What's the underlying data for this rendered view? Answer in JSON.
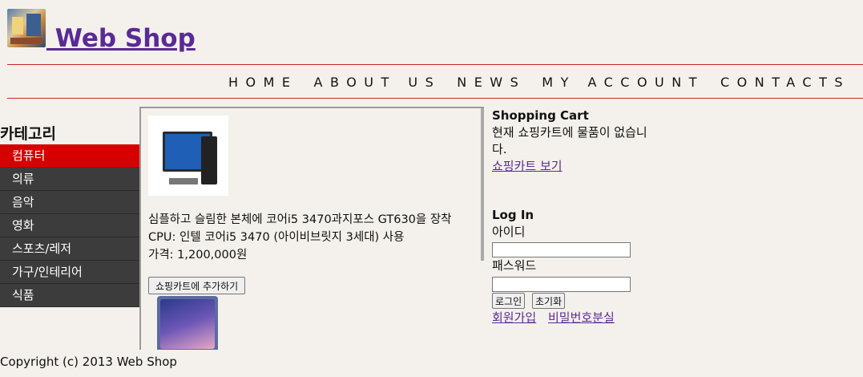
{
  "header": {
    "title": " Web Shop",
    "logo_icon": "shop-logo-icon"
  },
  "nav": {
    "items": [
      "HOME",
      "ABOUT US",
      "NEWS",
      "MY ACCOUNT",
      "CONTACTS"
    ]
  },
  "sidebar": {
    "title": "카테고리",
    "items": [
      "컴퓨터",
      "의류",
      "음악",
      "영화",
      "스포츠/레저",
      "가구/인테리어",
      "식품"
    ],
    "active_color": "#d60000",
    "item_color": "#3c3c3c"
  },
  "product": {
    "description": "심플하고 슬림한 본체에 코어i5 3470과지포스 GT630을 장착 CPU: 인텔 코어i5 3470 (아이비브릿지 3세대) 사용",
    "price": "가격: 1,200,000원",
    "add_button": "쇼핑카트에 추가하기"
  },
  "cart": {
    "title": "Shopping Cart",
    "message": "현재 쇼핑카트에 물품이 없습니다.",
    "view_link": "쇼핑카트 보기"
  },
  "login": {
    "title": "Log In",
    "id_label": "아이디",
    "pw_label": "패스워드",
    "login_button": "로그인",
    "reset_button": "초기화",
    "join_link": "회원가입",
    "find_pw_link": "비밀번호분실"
  },
  "footer": {
    "text": "Copyright (c) 2013 Web Shop"
  },
  "colors": {
    "background": "#f4f1ec",
    "link": "#5a2a96",
    "rule": "#c62a2a"
  }
}
